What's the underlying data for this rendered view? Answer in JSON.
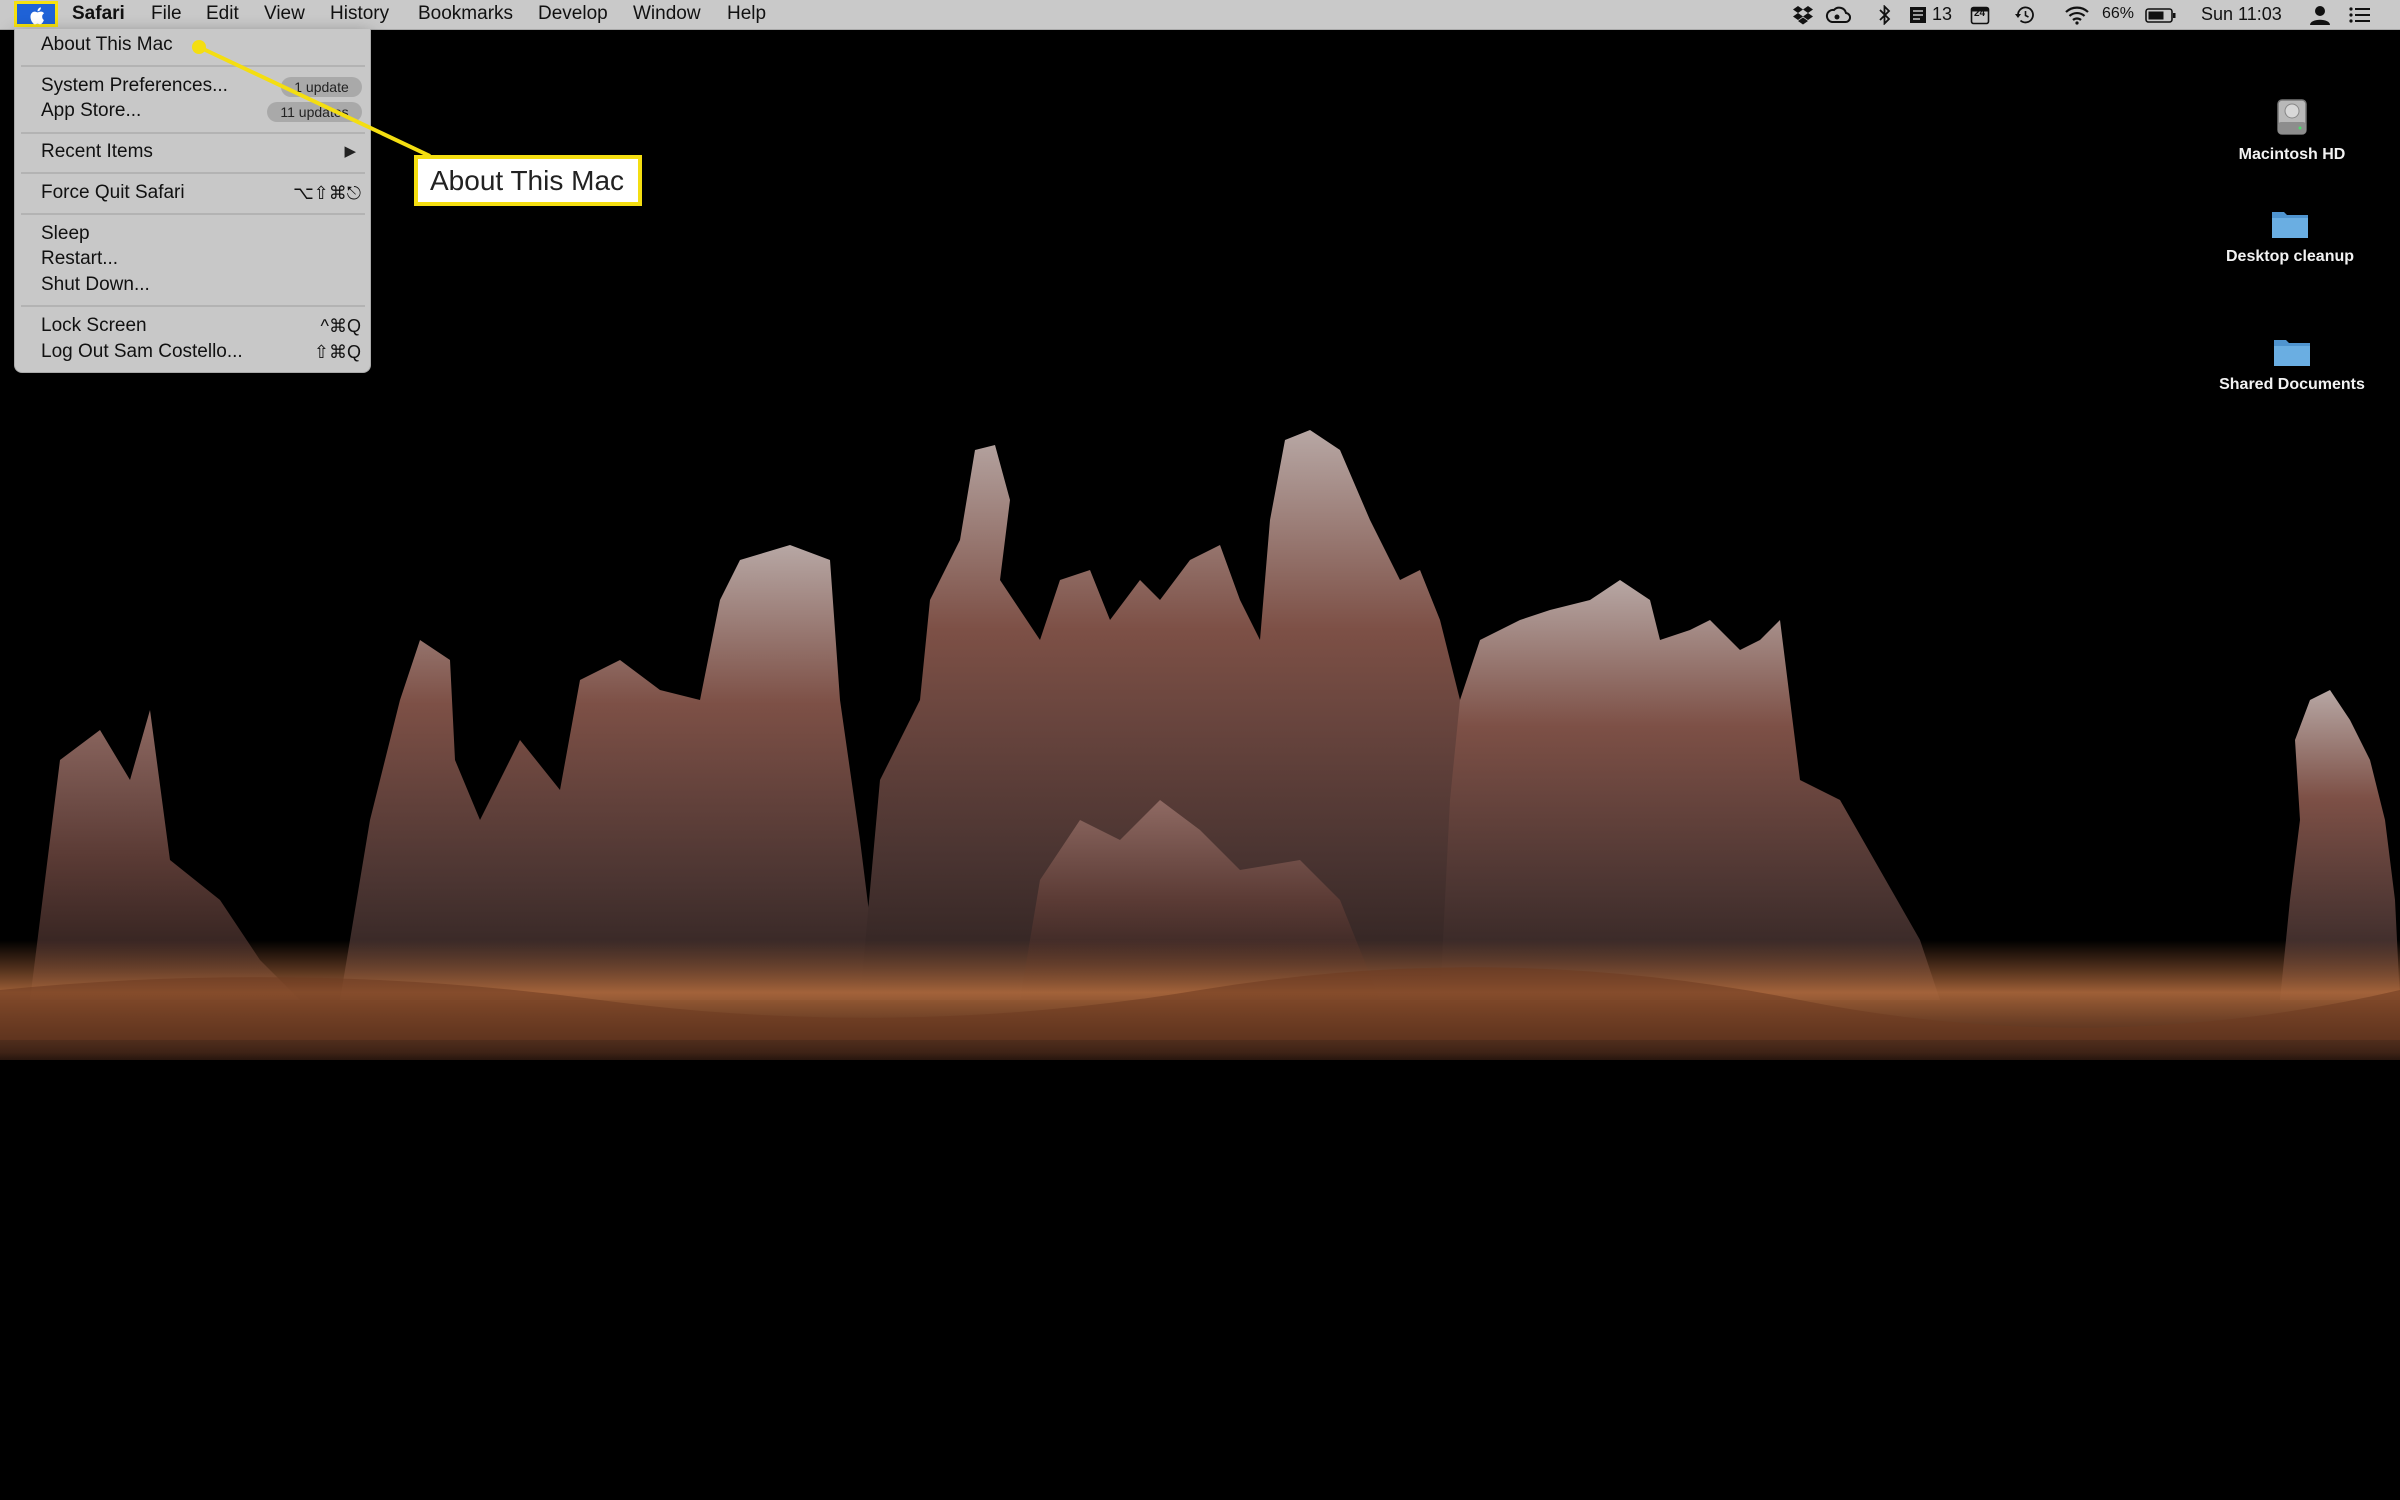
{
  "menubar": {
    "app_name": "Safari",
    "items": [
      "File",
      "Edit",
      "View",
      "History",
      "Bookmarks",
      "Develop",
      "Window",
      "Help"
    ],
    "status": {
      "notification_count": "13",
      "calendar_date": "24",
      "battery_percent": "66%",
      "clock": "Sun 11:03"
    }
  },
  "apple_menu": {
    "about": "About This Mac",
    "system_preferences": "System Preferences...",
    "system_preferences_badge": "1 update",
    "app_store": "App Store...",
    "app_store_badge": "11 updates",
    "recent_items": "Recent Items",
    "force_quit": "Force Quit Safari",
    "force_quit_shortcut": "⌥⇧⌘⎋",
    "sleep": "Sleep",
    "restart": "Restart...",
    "shut_down": "Shut Down...",
    "lock_screen": "Lock Screen",
    "lock_screen_shortcut": "^⌘Q",
    "log_out": "Log Out Sam Costello...",
    "log_out_shortcut": "⇧⌘Q"
  },
  "callout": {
    "text": "About This Mac",
    "color": "#f4de11"
  },
  "desktop_icons": [
    {
      "label": "Macintosh HD",
      "icon": "hard-drive-icon"
    },
    {
      "label": "Desktop cleanup",
      "icon": "folder-icon"
    },
    {
      "label": "Shared Documents",
      "icon": "folder-icon"
    }
  ],
  "colors": {
    "menubar_bg": "#c9c9c9",
    "apple_highlight": "#1f62d7",
    "annotation_yellow": "#f4de11",
    "folder_blue": "#6aaee2"
  }
}
